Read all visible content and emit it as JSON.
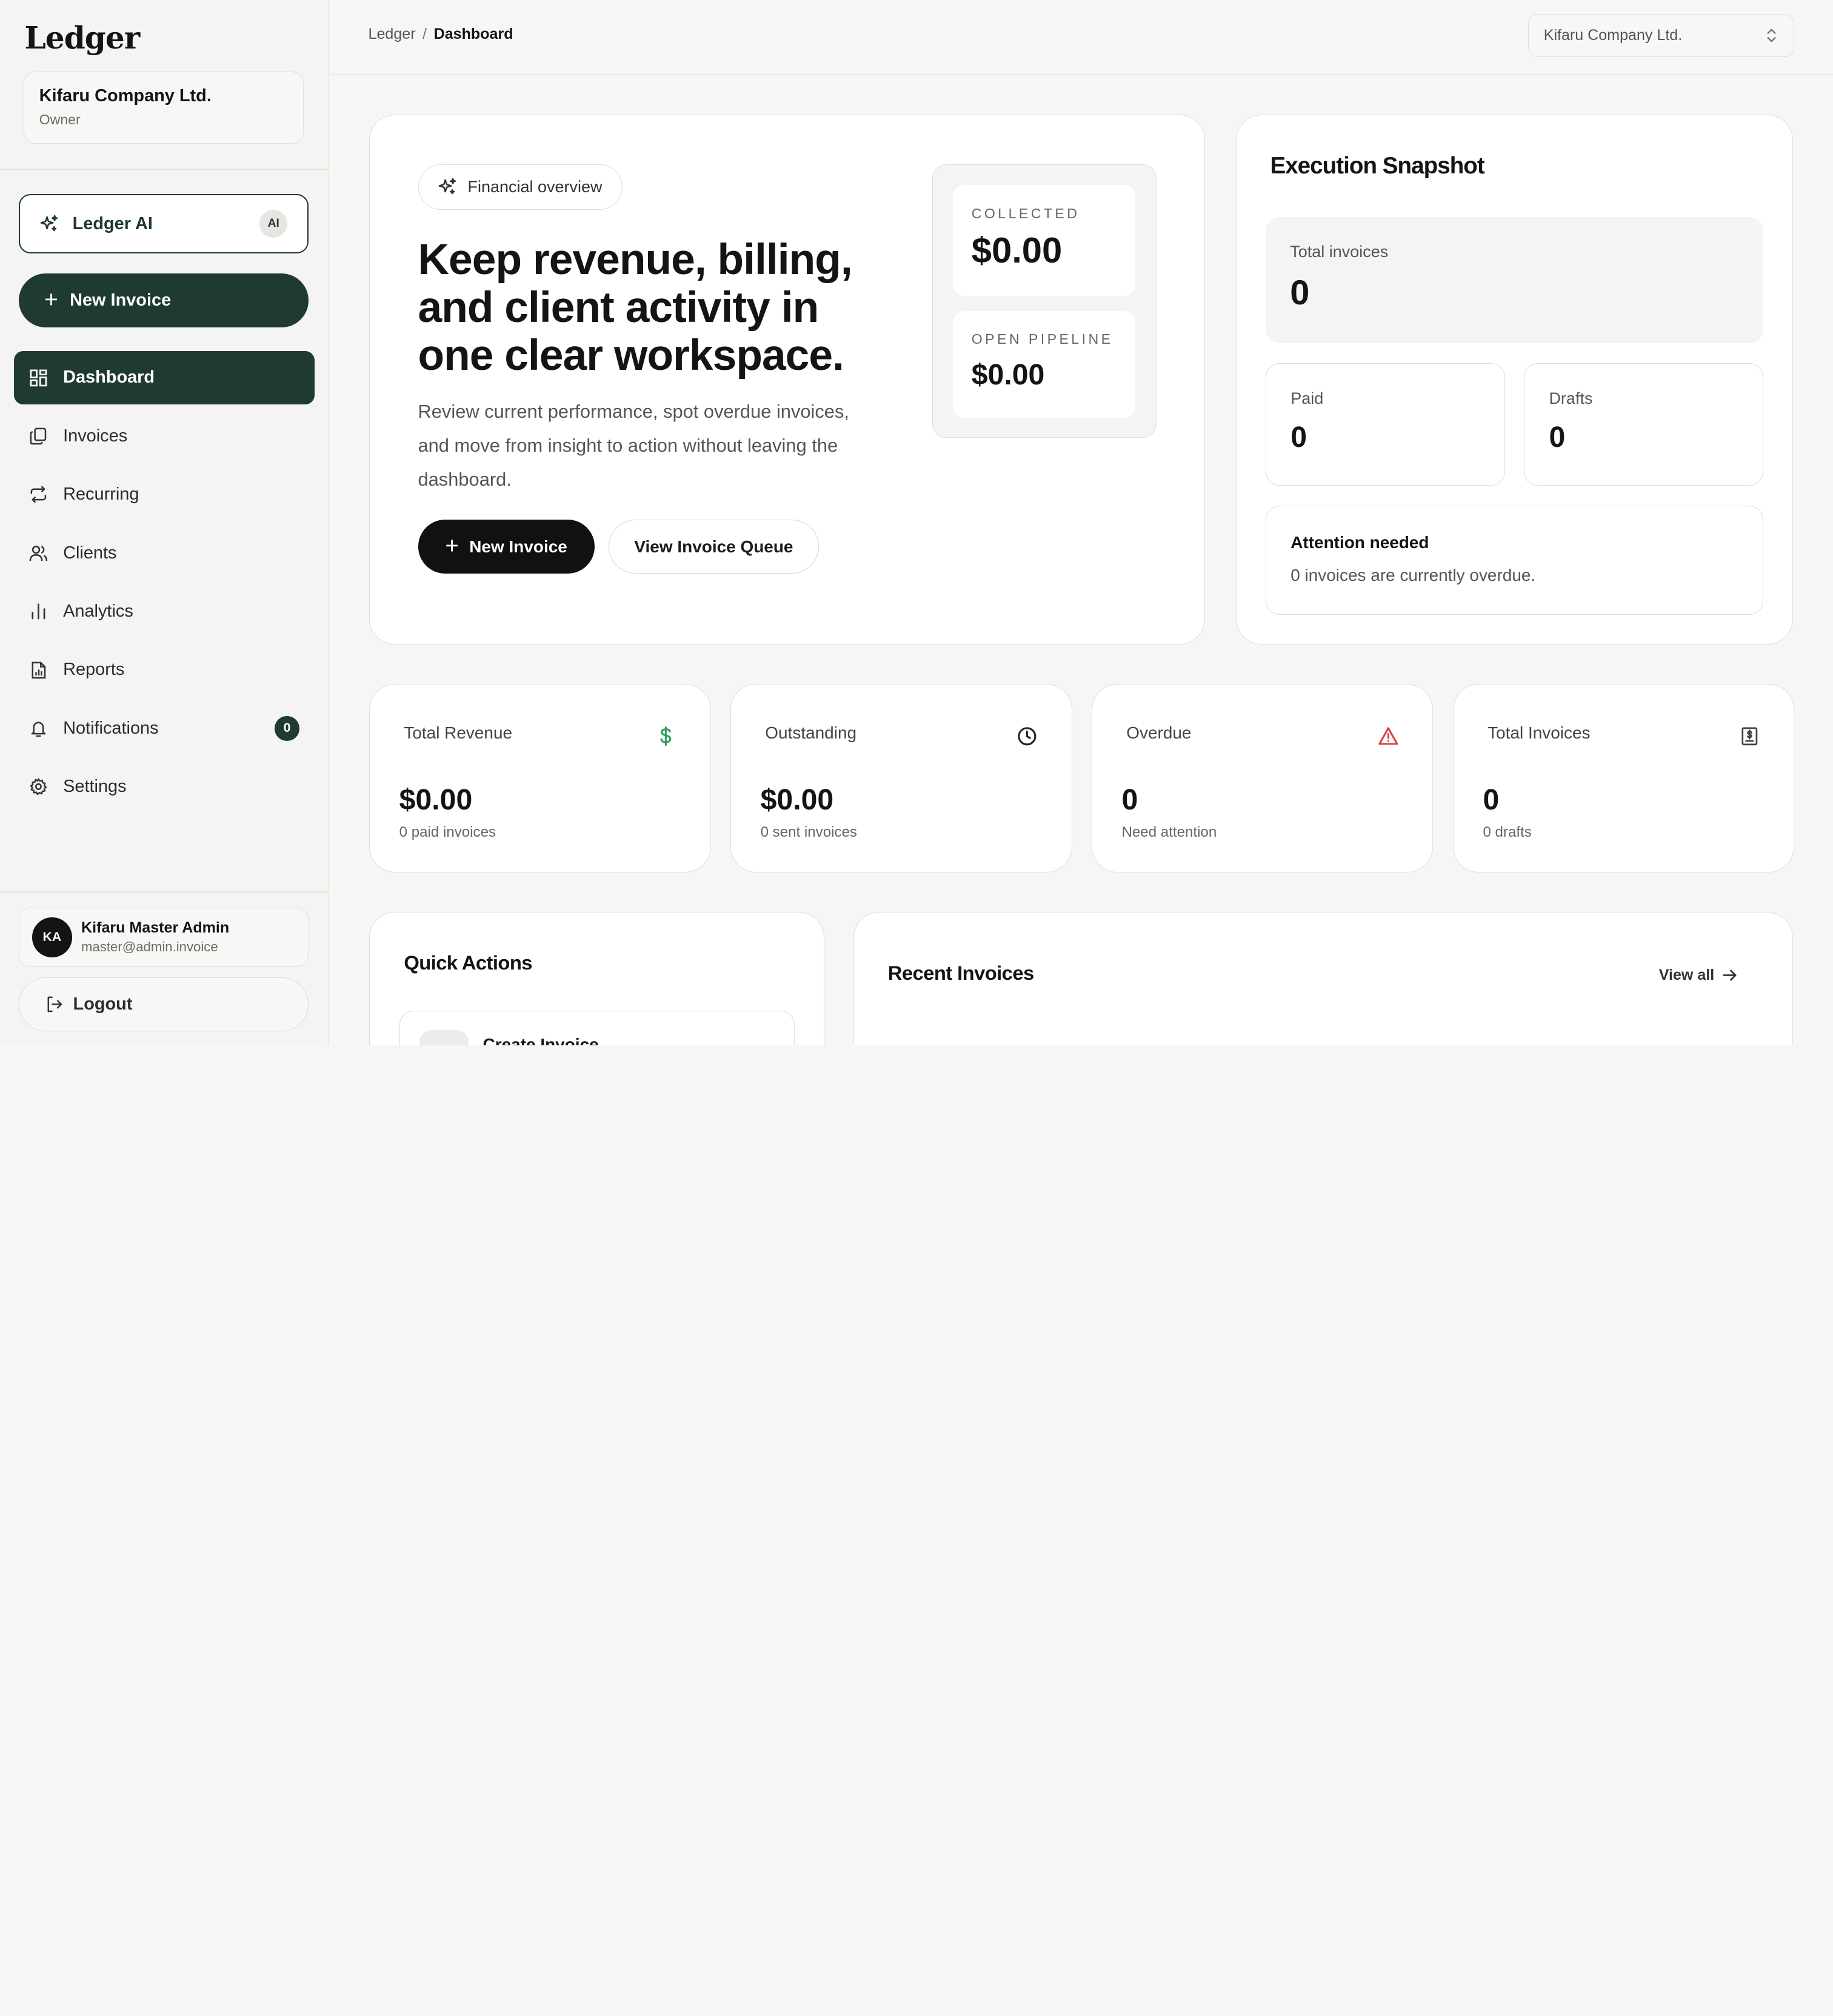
{
  "sidebar": {
    "brand": "Ledger",
    "org": {
      "name": "Kifaru Company Ltd.",
      "role": "Owner"
    },
    "ai_button": {
      "label": "Ledger AI",
      "badge": "AI"
    },
    "new_invoice_label": "New Invoice",
    "nav": [
      {
        "label": "Dashboard",
        "icon": "dashboard-icon",
        "active": true
      },
      {
        "label": "Invoices",
        "icon": "invoices-icon"
      },
      {
        "label": "Recurring",
        "icon": "recurring-icon"
      },
      {
        "label": "Clients",
        "icon": "clients-icon"
      },
      {
        "label": "Analytics",
        "icon": "analytics-icon"
      },
      {
        "label": "Reports",
        "icon": "reports-icon"
      },
      {
        "label": "Notifications",
        "icon": "bell-icon",
        "badge": "0"
      },
      {
        "label": "Settings",
        "icon": "gear-icon"
      }
    ],
    "user": {
      "initials": "KA",
      "name": "Kifaru Master Admin",
      "email": "master@admin.invoice"
    },
    "logout_label": "Logout"
  },
  "topbar": {
    "breadcrumb": [
      "Ledger",
      "Dashboard"
    ],
    "breadcrumb_sep": "/",
    "org_select": "Kifaru Company Ltd."
  },
  "hero": {
    "pill": "Financial overview",
    "title": "Keep revenue, billing, and client activity in one clear workspace.",
    "subtitle": "Review current performance, spot overdue invoices, and move from insight to action without leaving the dashboard.",
    "primary_button": "New Invoice",
    "secondary_button": "View Invoice Queue",
    "metrics": [
      {
        "label": "COLLECTED",
        "value": "$0.00"
      },
      {
        "label": "OPEN PIPELINE",
        "value": "$0.00"
      }
    ]
  },
  "snapshot": {
    "title": "Execution Snapshot",
    "total": {
      "label": "Total invoices",
      "value": "0"
    },
    "paid": {
      "label": "Paid",
      "value": "0"
    },
    "drafts": {
      "label": "Drafts",
      "value": "0"
    },
    "attention": {
      "title": "Attention needed",
      "text": "0 invoices are currently overdue."
    }
  },
  "stats": [
    {
      "label": "Total Revenue",
      "value": "$0.00",
      "sub": "0 paid invoices",
      "icon": "dollar-icon",
      "color": "#2f9e5b"
    },
    {
      "label": "Outstanding",
      "value": "$0.00",
      "sub": "0 sent invoices",
      "icon": "clock-icon",
      "color": "#222222"
    },
    {
      "label": "Overdue",
      "value": "0",
      "sub": "Need attention",
      "icon": "warning-icon",
      "color": "#d64545"
    },
    {
      "label": "Total Invoices",
      "value": "0",
      "sub": "0 drafts",
      "icon": "receipt-icon",
      "color": "#444444"
    }
  ],
  "quick_actions": {
    "title": "Quick Actions",
    "first_item": "Create Invoice"
  },
  "recent_invoices": {
    "title": "Recent Invoices",
    "view_all": "View all"
  },
  "colors": {
    "accent": "#1f3a33",
    "background": "#f6f6f4",
    "card": "#ffffff"
  }
}
